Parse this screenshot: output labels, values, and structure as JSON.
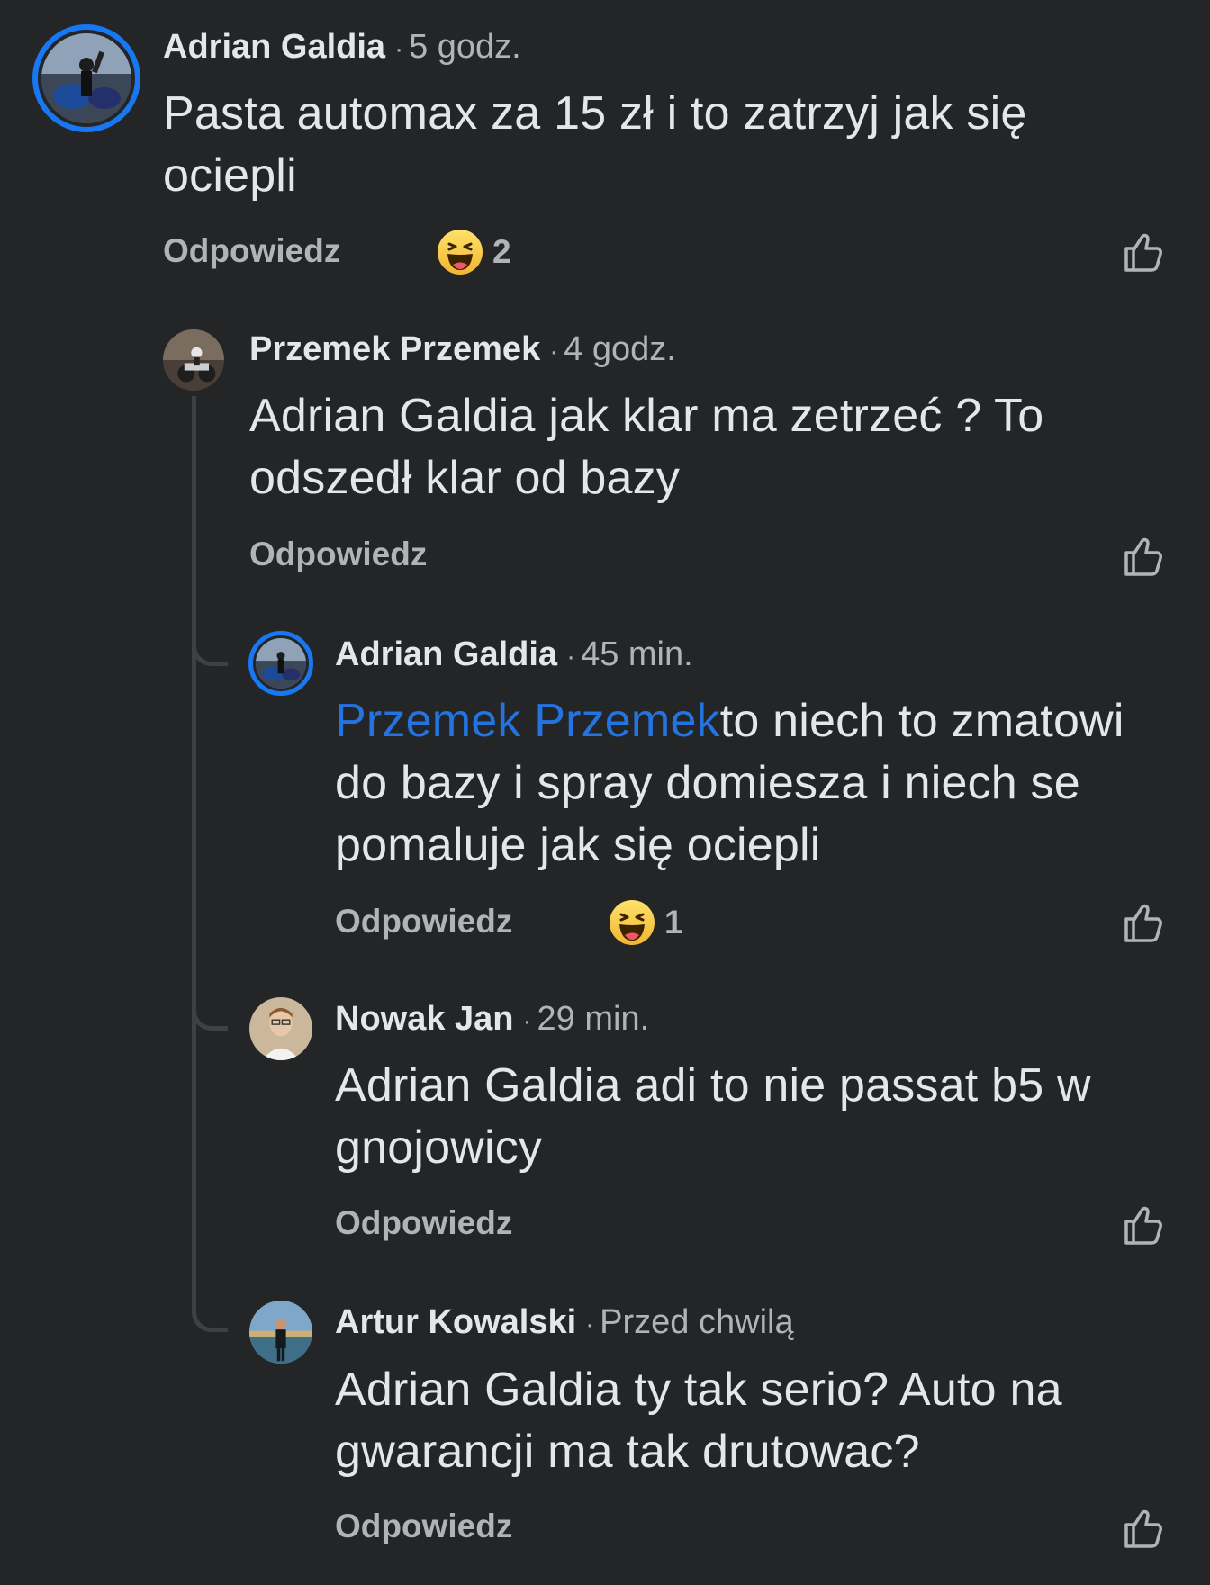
{
  "comments": [
    {
      "author": "Adrian Galdia",
      "time": "5 godz.",
      "text": "Pasta automax za 15 zł i to zatrzyj jak się ociepli",
      "reply_label": "Odpowiedz",
      "reaction": {
        "icon": "haha-emoji-icon",
        "count": "2"
      }
    },
    {
      "author": "Przemek Przemek",
      "time": "4 godz.",
      "text": "Adrian Galdia jak klar ma zetrzeć ? To odszedł klar od bazy",
      "reply_label": "Odpowiedz"
    },
    {
      "author": "Adrian Galdia",
      "time": "45 min.",
      "mention": "Przemek Przemek",
      "text": "to niech to zmatowi do bazy i spray domiesza i niech se pomaluje jak się ociepli",
      "reply_label": "Odpowiedz",
      "reaction": {
        "icon": "haha-emoji-icon",
        "count": "1"
      }
    },
    {
      "author": "Nowak Jan",
      "time": "29 min.",
      "text": "Adrian Galdia adi to nie passat b5 w gnojowicy",
      "reply_label": "Odpowiedz"
    },
    {
      "author": "Artur Kowalski",
      "time": "Przed chwilą",
      "text": "Adrian Galdia ty tak serio? Auto na gwarancji ma tak drutowac?",
      "reply_label": "Odpowiedz"
    }
  ],
  "separator": "·",
  "colors": {
    "background": "#242526",
    "primary_text": "#e4e6eb",
    "secondary_text": "#b0b3b8",
    "mention": "#2374e1",
    "story_ring": "#1877f2"
  }
}
